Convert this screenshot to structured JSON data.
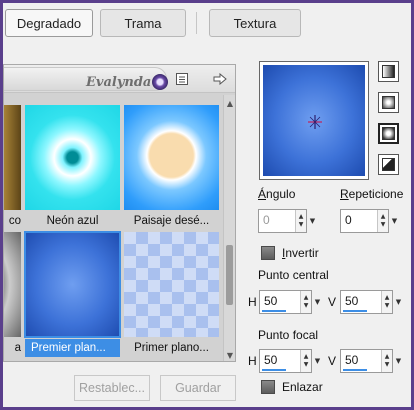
{
  "tabs": [
    {
      "label": "Degradado",
      "active": true
    },
    {
      "label": "Trama",
      "active": false
    },
    {
      "label": "Textura",
      "active": false
    }
  ],
  "browser": {
    "logo_text": "Evalynda",
    "presets": [
      {
        "label": "co",
        "partial": true
      },
      {
        "label": "Neón azul"
      },
      {
        "label": "Paisaje desé..."
      },
      {
        "label": "a",
        "partial": true
      },
      {
        "label": "Premier plan...",
        "selected": true
      },
      {
        "label": "Primer plano..."
      }
    ]
  },
  "actions": {
    "reset_label": "Restablec...",
    "save_label": "Guardar"
  },
  "gradient": {
    "angle_label": "Ángulo",
    "angle_value": "0",
    "repeats_label": "Repeticione",
    "repeats_value": "0",
    "invert_label": "Invertir",
    "center_label": "Punto central",
    "center_h": "50",
    "center_v": "50",
    "focal_label": "Punto focal",
    "focal_h": "50",
    "focal_v": "50",
    "h_label": "H",
    "v_label": "V",
    "link_label": "Enlazar"
  },
  "colors": {
    "accent": "#3d8ee5",
    "gradient_center": "#6f9ef0",
    "gradient_edge": "#1e4cb0"
  }
}
